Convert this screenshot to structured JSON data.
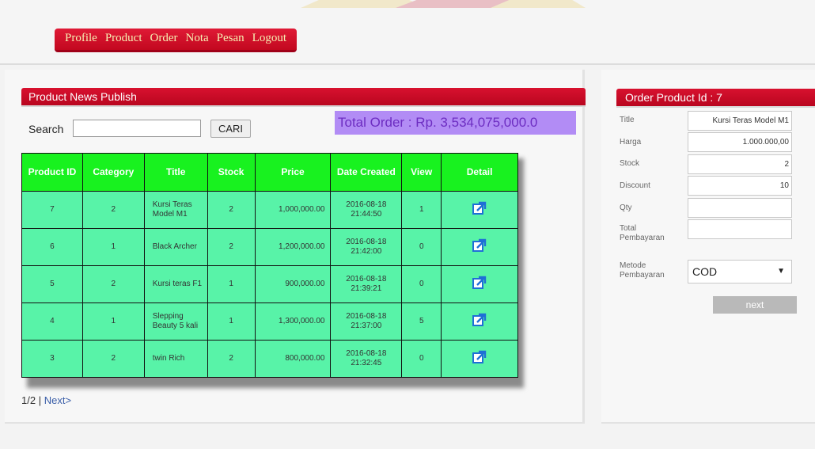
{
  "nav": {
    "items": [
      "Profile",
      "Product",
      "Order",
      "Nota",
      "Pesan",
      "Logout"
    ]
  },
  "product_panel": {
    "title": "Product News Publish",
    "search_label": "Search",
    "search_value": "",
    "search_button": "CARI",
    "total_order": "Total Order : Rp. 3,534,075,000.0"
  },
  "table": {
    "headers": [
      "Product ID",
      "Category",
      "Title",
      "Stock",
      "Price",
      "Date Created",
      "View",
      "Detail"
    ],
    "rows": [
      {
        "id": "7",
        "category": "2",
        "title": "Kursi Teras Model M1",
        "stock": "2",
        "price": "1,000,000.00",
        "date": "2016-08-18",
        "time": "21:44:50",
        "view": "1"
      },
      {
        "id": "6",
        "category": "1",
        "title": "Black Archer",
        "stock": "2",
        "price": "1,200,000.00",
        "date": "2016-08-18",
        "time": "21:42:00",
        "view": "0"
      },
      {
        "id": "5",
        "category": "2",
        "title": "Kursi teras F1",
        "stock": "1",
        "price": "900,000.00",
        "date": "2016-08-18",
        "time": "21:39:21",
        "view": "0"
      },
      {
        "id": "4",
        "category": "1",
        "title": "Slepping Beauty 5 kali",
        "stock": "1",
        "price": "1,300,000.00",
        "date": "2016-08-18",
        "time": "21:37:00",
        "view": "5"
      },
      {
        "id": "3",
        "category": "2",
        "title": "twin Rich",
        "stock": "2",
        "price": "800,000.00",
        "date": "2016-08-18",
        "time": "21:32:45",
        "view": "0"
      }
    ],
    "detail_icon": "external-link-icon"
  },
  "pager": {
    "page": "1/2",
    "separator": "|",
    "next": "Next>"
  },
  "order_panel": {
    "title": "Order Product Id : 7",
    "fields": {
      "title_label": "Title",
      "title_value": "Kursi Teras Model M1",
      "harga_label": "Harga",
      "harga_value": "1.000.000,00",
      "stock_label": "Stock",
      "stock_value": "2",
      "discount_label": "Discount",
      "discount_value": "10",
      "qty_label": "Qty",
      "qty_value": "",
      "total_label": "Total Pembayaran",
      "total_value": "",
      "metode_label": "Metode Pembayaran",
      "metode_value": "COD"
    },
    "next_button": "next"
  },
  "colors": {
    "accent_red": "#c90a26",
    "nav_text": "#f6f1b3",
    "table_header": "#18f21f",
    "table_cell": "#58f3a8",
    "total_order_bg": "#b28cf5",
    "total_order_text": "#6d2dc2",
    "detail_icon": "#1f6fd6"
  }
}
